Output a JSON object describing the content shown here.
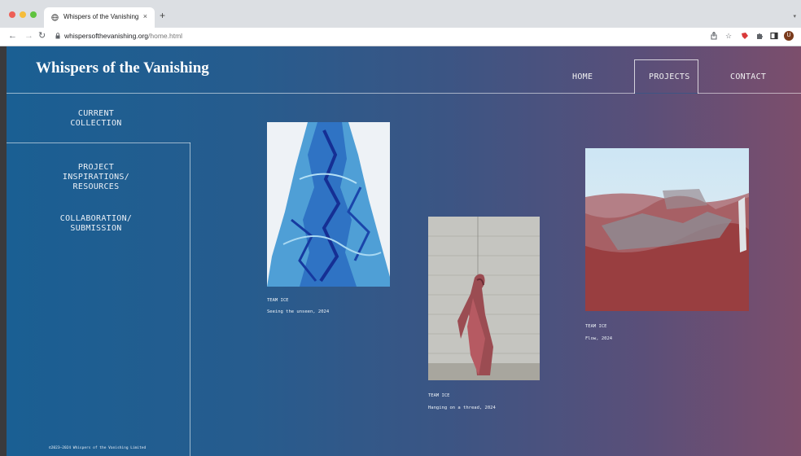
{
  "browser": {
    "tab_title": "Whispers of the Vanishing",
    "tab_close": "×",
    "new_tab": "+",
    "url_domain": "whispersofthevanishing.org",
    "url_path": "/home.html",
    "avatar_letter": "U",
    "icons": [
      "share-icon",
      "star-icon",
      "extension-red-icon",
      "puzzle-icon",
      "sidepanel-icon",
      "profile-icon"
    ]
  },
  "site": {
    "brand": "Whispers of the Vanishing",
    "nav": [
      {
        "label": "HOME"
      },
      {
        "label": "PROJECTS",
        "active": true
      },
      {
        "label": "CONTACT"
      }
    ],
    "sidebar": {
      "current": {
        "line1": "CURRENT",
        "line2": "COLLECTION"
      },
      "inspirations": {
        "line1": "PROJECT",
        "line2": "INSPIRATIONS/",
        "line3": "RESOURCES"
      },
      "collaboration": {
        "line1": "COLLABORATION/",
        "line2": "SUBMISSION"
      }
    },
    "footer": "©2023–2024 Whispers of the Vanishing Limited",
    "artworks": [
      {
        "team": "TEAM ICE",
        "title": "Seeing the unseen, 2024"
      },
      {
        "team": "TEAM ICE",
        "title": "Hanging on a thread, 2024"
      },
      {
        "team": "TEAM ICE",
        "title": "Flow, 2024"
      }
    ],
    "colors": {
      "gradient_left": "#1a5f93",
      "gradient_right": "#7c4e6c",
      "text": "#ffffff"
    }
  }
}
